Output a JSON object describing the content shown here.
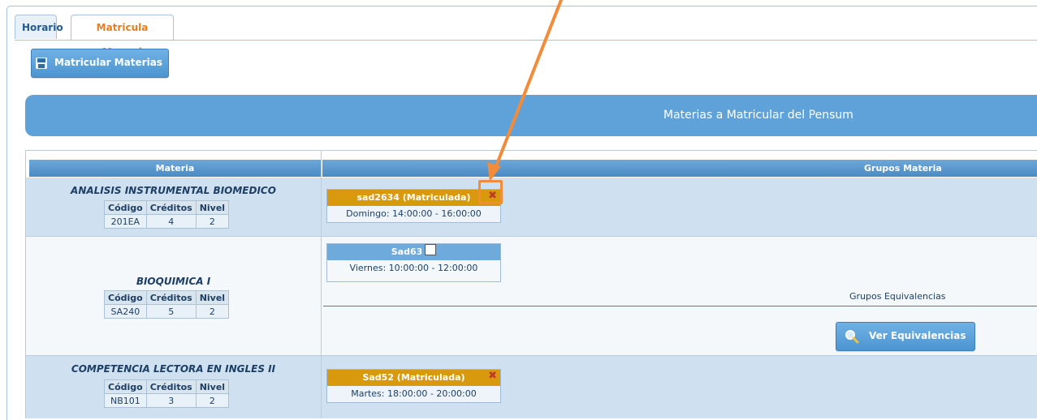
{
  "tabs": [
    {
      "label": "Horario"
    },
    {
      "label": "Matricula Manual"
    }
  ],
  "toolbar": {
    "matricular_label": "Matricular Materias"
  },
  "banner": {
    "title": "Materias a Matricular del Pensum"
  },
  "table": {
    "headers": {
      "materia": "Materia",
      "grupos": "Grupos Materia"
    },
    "col_labels": {
      "codigo": "Código",
      "creditos": "Créditos",
      "nivel": "Nivel"
    },
    "rows": [
      {
        "name": "ANALISIS INSTRUMENTAL BIOMEDICO",
        "codigo": "201EA",
        "creditos": "4",
        "nivel": "2",
        "group": {
          "title": "sad2634 (Matriculada)",
          "schedule": "Domingo: 14:00:00 - 16:00:00",
          "status": "matriculada"
        }
      },
      {
        "name": "BIOQUIMICA I",
        "codigo": "SA240",
        "creditos": "5",
        "nivel": "2",
        "group": {
          "title": "Sad63",
          "schedule": "Viernes: 10:00:00 - 12:00:00",
          "status": "available"
        },
        "equivalencias_label": "Grupos Equivalencias",
        "ver_equivalencias_label": "Ver Equivalencias"
      },
      {
        "name": "COMPETENCIA LECTORA EN INGLES II",
        "codigo": "NB101",
        "creditos": "3",
        "nivel": "2",
        "group": {
          "title": "Sad52 (Matriculada)",
          "schedule": "Martes: 18:00:00 - 20:00:00",
          "status": "matriculada"
        }
      }
    ]
  },
  "colors": {
    "accent": "#5fa2d9",
    "orange": "#d9990d",
    "highlight": "#f28c3a",
    "tab_active_text": "#e67e22"
  }
}
